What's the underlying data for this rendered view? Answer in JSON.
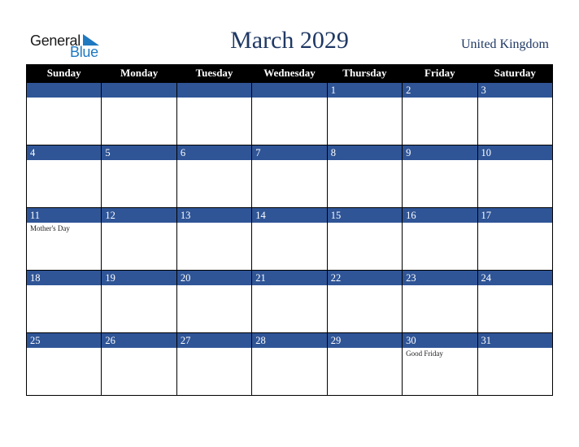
{
  "logo": {
    "word1": "General",
    "word2": "Blue"
  },
  "title": "March 2029",
  "country": "United Kingdom",
  "colors": {
    "header_bg": "#000000",
    "band": "#2f5597",
    "title": "#1f3864",
    "logo_blue": "#1f79c1"
  },
  "weekdays": [
    "Sunday",
    "Monday",
    "Tuesday",
    "Wednesday",
    "Thursday",
    "Friday",
    "Saturday"
  ],
  "weeks": [
    [
      {
        "day": "",
        "event": ""
      },
      {
        "day": "",
        "event": ""
      },
      {
        "day": "",
        "event": ""
      },
      {
        "day": "",
        "event": ""
      },
      {
        "day": "1",
        "event": ""
      },
      {
        "day": "2",
        "event": ""
      },
      {
        "day": "3",
        "event": ""
      }
    ],
    [
      {
        "day": "4",
        "event": ""
      },
      {
        "day": "5",
        "event": ""
      },
      {
        "day": "6",
        "event": ""
      },
      {
        "day": "7",
        "event": ""
      },
      {
        "day": "8",
        "event": ""
      },
      {
        "day": "9",
        "event": ""
      },
      {
        "day": "10",
        "event": ""
      }
    ],
    [
      {
        "day": "11",
        "event": "Mother's Day"
      },
      {
        "day": "12",
        "event": ""
      },
      {
        "day": "13",
        "event": ""
      },
      {
        "day": "14",
        "event": ""
      },
      {
        "day": "15",
        "event": ""
      },
      {
        "day": "16",
        "event": ""
      },
      {
        "day": "17",
        "event": ""
      }
    ],
    [
      {
        "day": "18",
        "event": ""
      },
      {
        "day": "19",
        "event": ""
      },
      {
        "day": "20",
        "event": ""
      },
      {
        "day": "21",
        "event": ""
      },
      {
        "day": "22",
        "event": ""
      },
      {
        "day": "23",
        "event": ""
      },
      {
        "day": "24",
        "event": ""
      }
    ],
    [
      {
        "day": "25",
        "event": ""
      },
      {
        "day": "26",
        "event": ""
      },
      {
        "day": "27",
        "event": ""
      },
      {
        "day": "28",
        "event": ""
      },
      {
        "day": "29",
        "event": ""
      },
      {
        "day": "30",
        "event": "Good Friday"
      },
      {
        "day": "31",
        "event": ""
      }
    ]
  ]
}
